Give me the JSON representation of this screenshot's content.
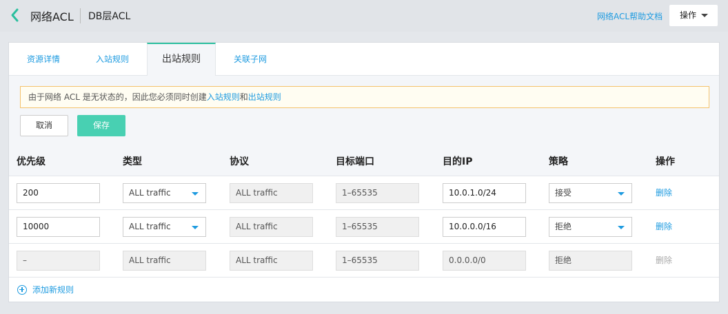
{
  "header": {
    "title": "网络ACL",
    "subtitle": "DB层ACL",
    "help_link": "网络ACL帮助文档",
    "actions_label": "操作"
  },
  "tabs": [
    {
      "label": "资源详情",
      "active": false
    },
    {
      "label": "入站规则",
      "active": false
    },
    {
      "label": "出站规则",
      "active": true
    },
    {
      "label": "关联子网",
      "active": false
    }
  ],
  "notice": {
    "text_before": "由于网络 ACL 是无状态的，因此您必须同时创建",
    "link_inbound": "入站规则",
    "text_mid": "和",
    "link_outbound": "出站规则"
  },
  "buttons": {
    "cancel": "取消",
    "save": "保存"
  },
  "table": {
    "headers": [
      "优先级",
      "类型",
      "协议",
      "目标端口",
      "目的IP",
      "策略",
      "操作"
    ],
    "rows": [
      {
        "priority": "200",
        "type": "ALL traffic",
        "protocol": "ALL traffic",
        "port": "1–65535",
        "dest_ip": "10.0.1.0/24",
        "policy": "接受",
        "action": "删除",
        "editable": true
      },
      {
        "priority": "10000",
        "type": "ALL traffic",
        "protocol": "ALL traffic",
        "port": "1–65535",
        "dest_ip": "10.0.0.0/16",
        "policy": "拒绝",
        "action": "删除",
        "editable": true
      },
      {
        "priority": "–",
        "type": "ALL traffic",
        "protocol": "ALL traffic",
        "port": "1–65535",
        "dest_ip": "0.0.0.0/0",
        "policy": "拒绝",
        "action": "删除",
        "editable": false
      }
    ]
  },
  "add_rule_label": "添加新规则",
  "colors": {
    "accent": "#2bbf9e",
    "link": "#1e9be0",
    "save": "#48d0b2",
    "notice_border": "#f5c26b"
  }
}
